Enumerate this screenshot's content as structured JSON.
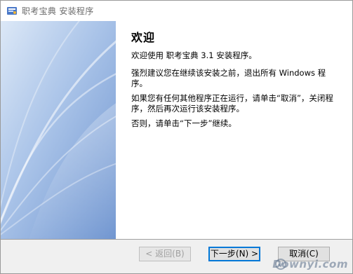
{
  "window": {
    "title": "职考宝典 安装程序"
  },
  "welcome": {
    "heading": "欢迎",
    "paragraphs": [
      "欢迎使用 职考宝典 3.1 安装程序。",
      "强烈建议您在继续该安装之前，退出所有 Windows 程序。",
      "如果您有任何其他程序正在运行，请单击“取消”，关闭程序，然后再次运行该安装程序。",
      "否则，请单击“下一步”继续。"
    ]
  },
  "buttons": {
    "back": "< 返回(B)",
    "next": "下一步(N) >",
    "cancel": "取消(C)"
  },
  "watermark": {
    "text": "Downyi.com"
  },
  "colors": {
    "banner_light": "#dfeaf8",
    "banner_dark": "#7fa3d6",
    "default_button_border": "#0078d7"
  }
}
